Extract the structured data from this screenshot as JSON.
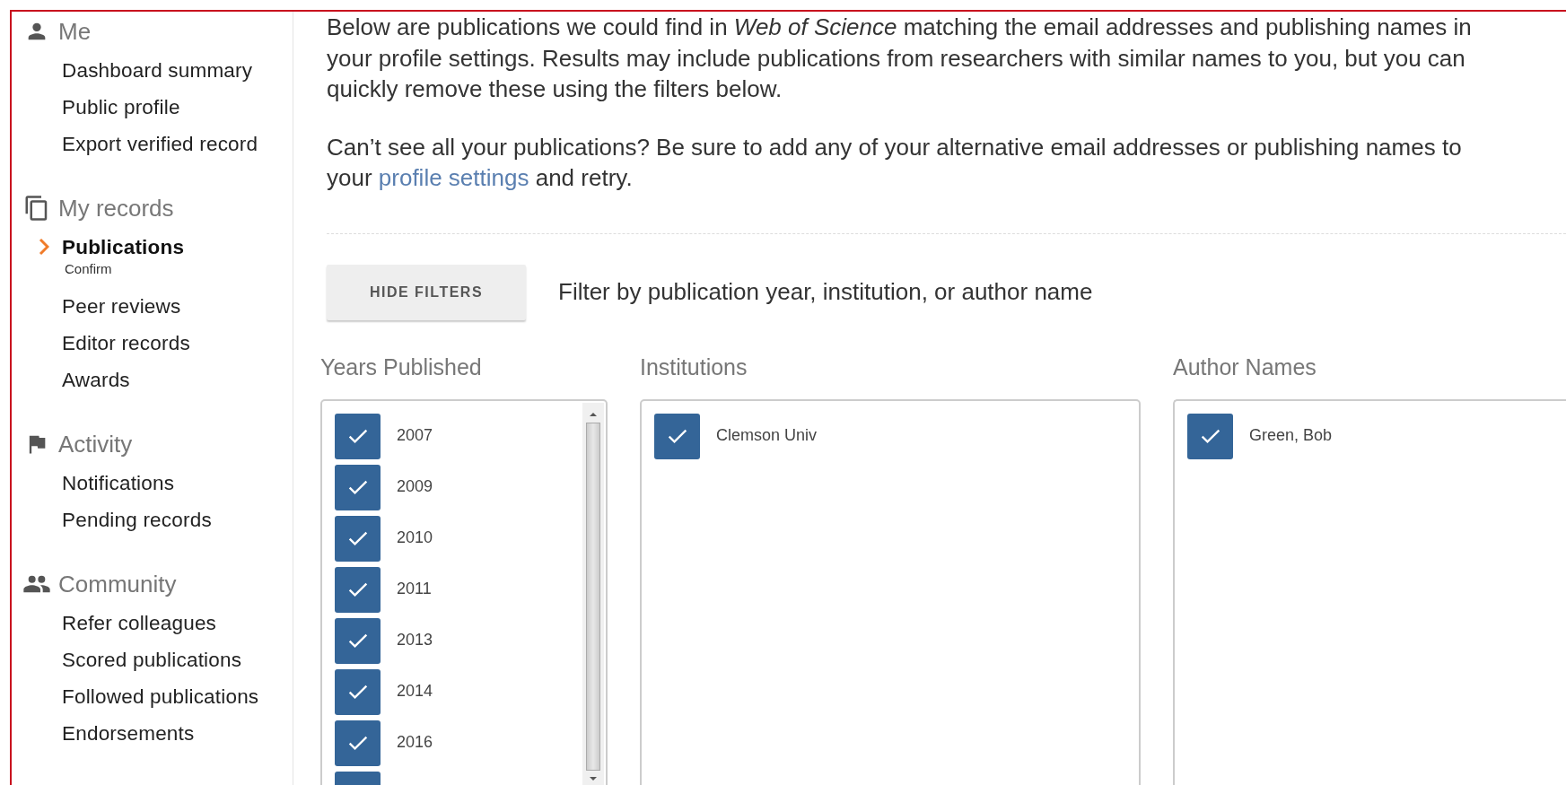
{
  "sidebar": {
    "sections": [
      {
        "title": "Me",
        "items": [
          {
            "label": "Dashboard summary",
            "selected": false
          },
          {
            "label": "Public profile",
            "selected": false
          },
          {
            "label": "Export verified record",
            "selected": false
          }
        ]
      },
      {
        "title": "My records",
        "items": [
          {
            "label": "Publications",
            "selected": true,
            "sub": "Confirm"
          },
          {
            "label": "Peer reviews",
            "selected": false
          },
          {
            "label": "Editor records",
            "selected": false
          },
          {
            "label": "Awards",
            "selected": false
          }
        ]
      },
      {
        "title": "Activity",
        "items": [
          {
            "label": "Notifications",
            "selected": false
          },
          {
            "label": "Pending records",
            "selected": false
          }
        ]
      },
      {
        "title": "Community",
        "items": [
          {
            "label": "Refer colleagues",
            "selected": false
          },
          {
            "label": "Scored publications",
            "selected": false
          },
          {
            "label": "Followed publications",
            "selected": false
          },
          {
            "label": "Endorsements",
            "selected": false
          }
        ]
      }
    ]
  },
  "intro": [
    "Below are publications we could find in *Web of Science* matching the email addresses and publishing names in your profile settings. Results may include publications from researchers with similar names to you, but you can quickly remove these using the filters below."
  ],
  "hint": {
    "before": "Can’t see all your publications? Be sure to add any of your alternative email addresses or publishing names to your",
    "link": "profile settings",
    "after": "and retry."
  },
  "filter_bar": {
    "button": "HIDE FILTERS",
    "description": "Filter by publication year, institution, or author name"
  },
  "filters": [
    {
      "title": "Years Published",
      "scrollable": true,
      "options": [
        {
          "label": "2007",
          "checked": true
        },
        {
          "label": "2009",
          "checked": true
        },
        {
          "label": "2010",
          "checked": true
        },
        {
          "label": "2011",
          "checked": true
        },
        {
          "label": "2013",
          "checked": true
        },
        {
          "label": "2014",
          "checked": true
        },
        {
          "label": "2016",
          "checked": true
        },
        {
          "checked": true
        }
      ]
    },
    {
      "title": "Institutions",
      "scrollable": false,
      "options": [
        {
          "label": "Clemson Univ",
          "checked": true
        }
      ]
    },
    {
      "title": "Author Names",
      "scrollable": false,
      "options": [
        {
          "label": "Green, Bob",
          "checked": true
        }
      ]
    }
  ]
}
